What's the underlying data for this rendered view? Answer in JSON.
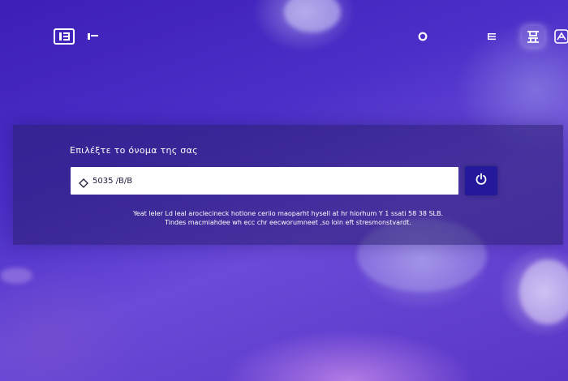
{
  "header": {
    "icons": [
      "app-logo-icon",
      "menu-icon",
      "record-icon",
      "list-icon",
      "language-icon",
      "settings-icon"
    ]
  },
  "panel": {
    "title": "Επιλέξτε το όνομα της σας",
    "input": {
      "value": "",
      "placeholder": "5035 /B/B"
    },
    "note_line1": "Yeat leler Ld leal aroclecineck hotlone ceriio maoparht hysell at hr hiorhum Y 1 ssati 58 38 SLB.",
    "note_line2": "Tindes macmiahdee wh ecc chr eecworumneet ,so loin eft stresmonstvardt."
  },
  "colors": {
    "background": "#4b2fc8",
    "panel": "#281e6e",
    "button": "#24199a",
    "input_bg": "#ffffff",
    "text": "#ffffff"
  }
}
